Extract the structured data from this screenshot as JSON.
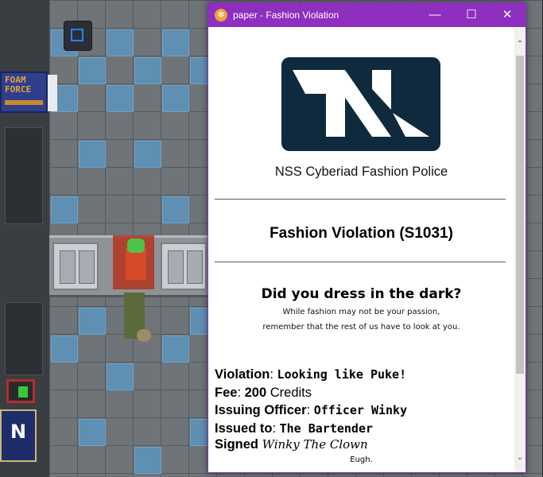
{
  "game": {
    "poster_text": "FOAM FORCE",
    "banner_letter": "N"
  },
  "window": {
    "title": "paper - Fashion Violation",
    "icon": "paper-icon",
    "controls": {
      "minimize": "—",
      "maximize": "☐",
      "close": "✕"
    },
    "accent": "#8e2fbf"
  },
  "paper": {
    "logo": "NSS logo",
    "org_name": "NSS Cyberiad Fashion Police",
    "doc_title": "Fashion Violation (S1031)",
    "question": "Did you dress in the dark?",
    "line1": "While fashion may not be your passion,",
    "line2": "remember that the rest of us have to look at you.",
    "violation_label": "Violation",
    "violation_value": "Looking like Puke!",
    "fee_label": "Fee",
    "fee_amount": "200",
    "fee_unit": "Credits",
    "officer_label": "Issuing Officer",
    "officer_value": "Officer Winky",
    "issued_to_label": "Issued to",
    "issued_to_value": "The Bartender",
    "signed_label": "Signed",
    "signed_value": "Winky The Clown",
    "closing": "Eugh."
  }
}
